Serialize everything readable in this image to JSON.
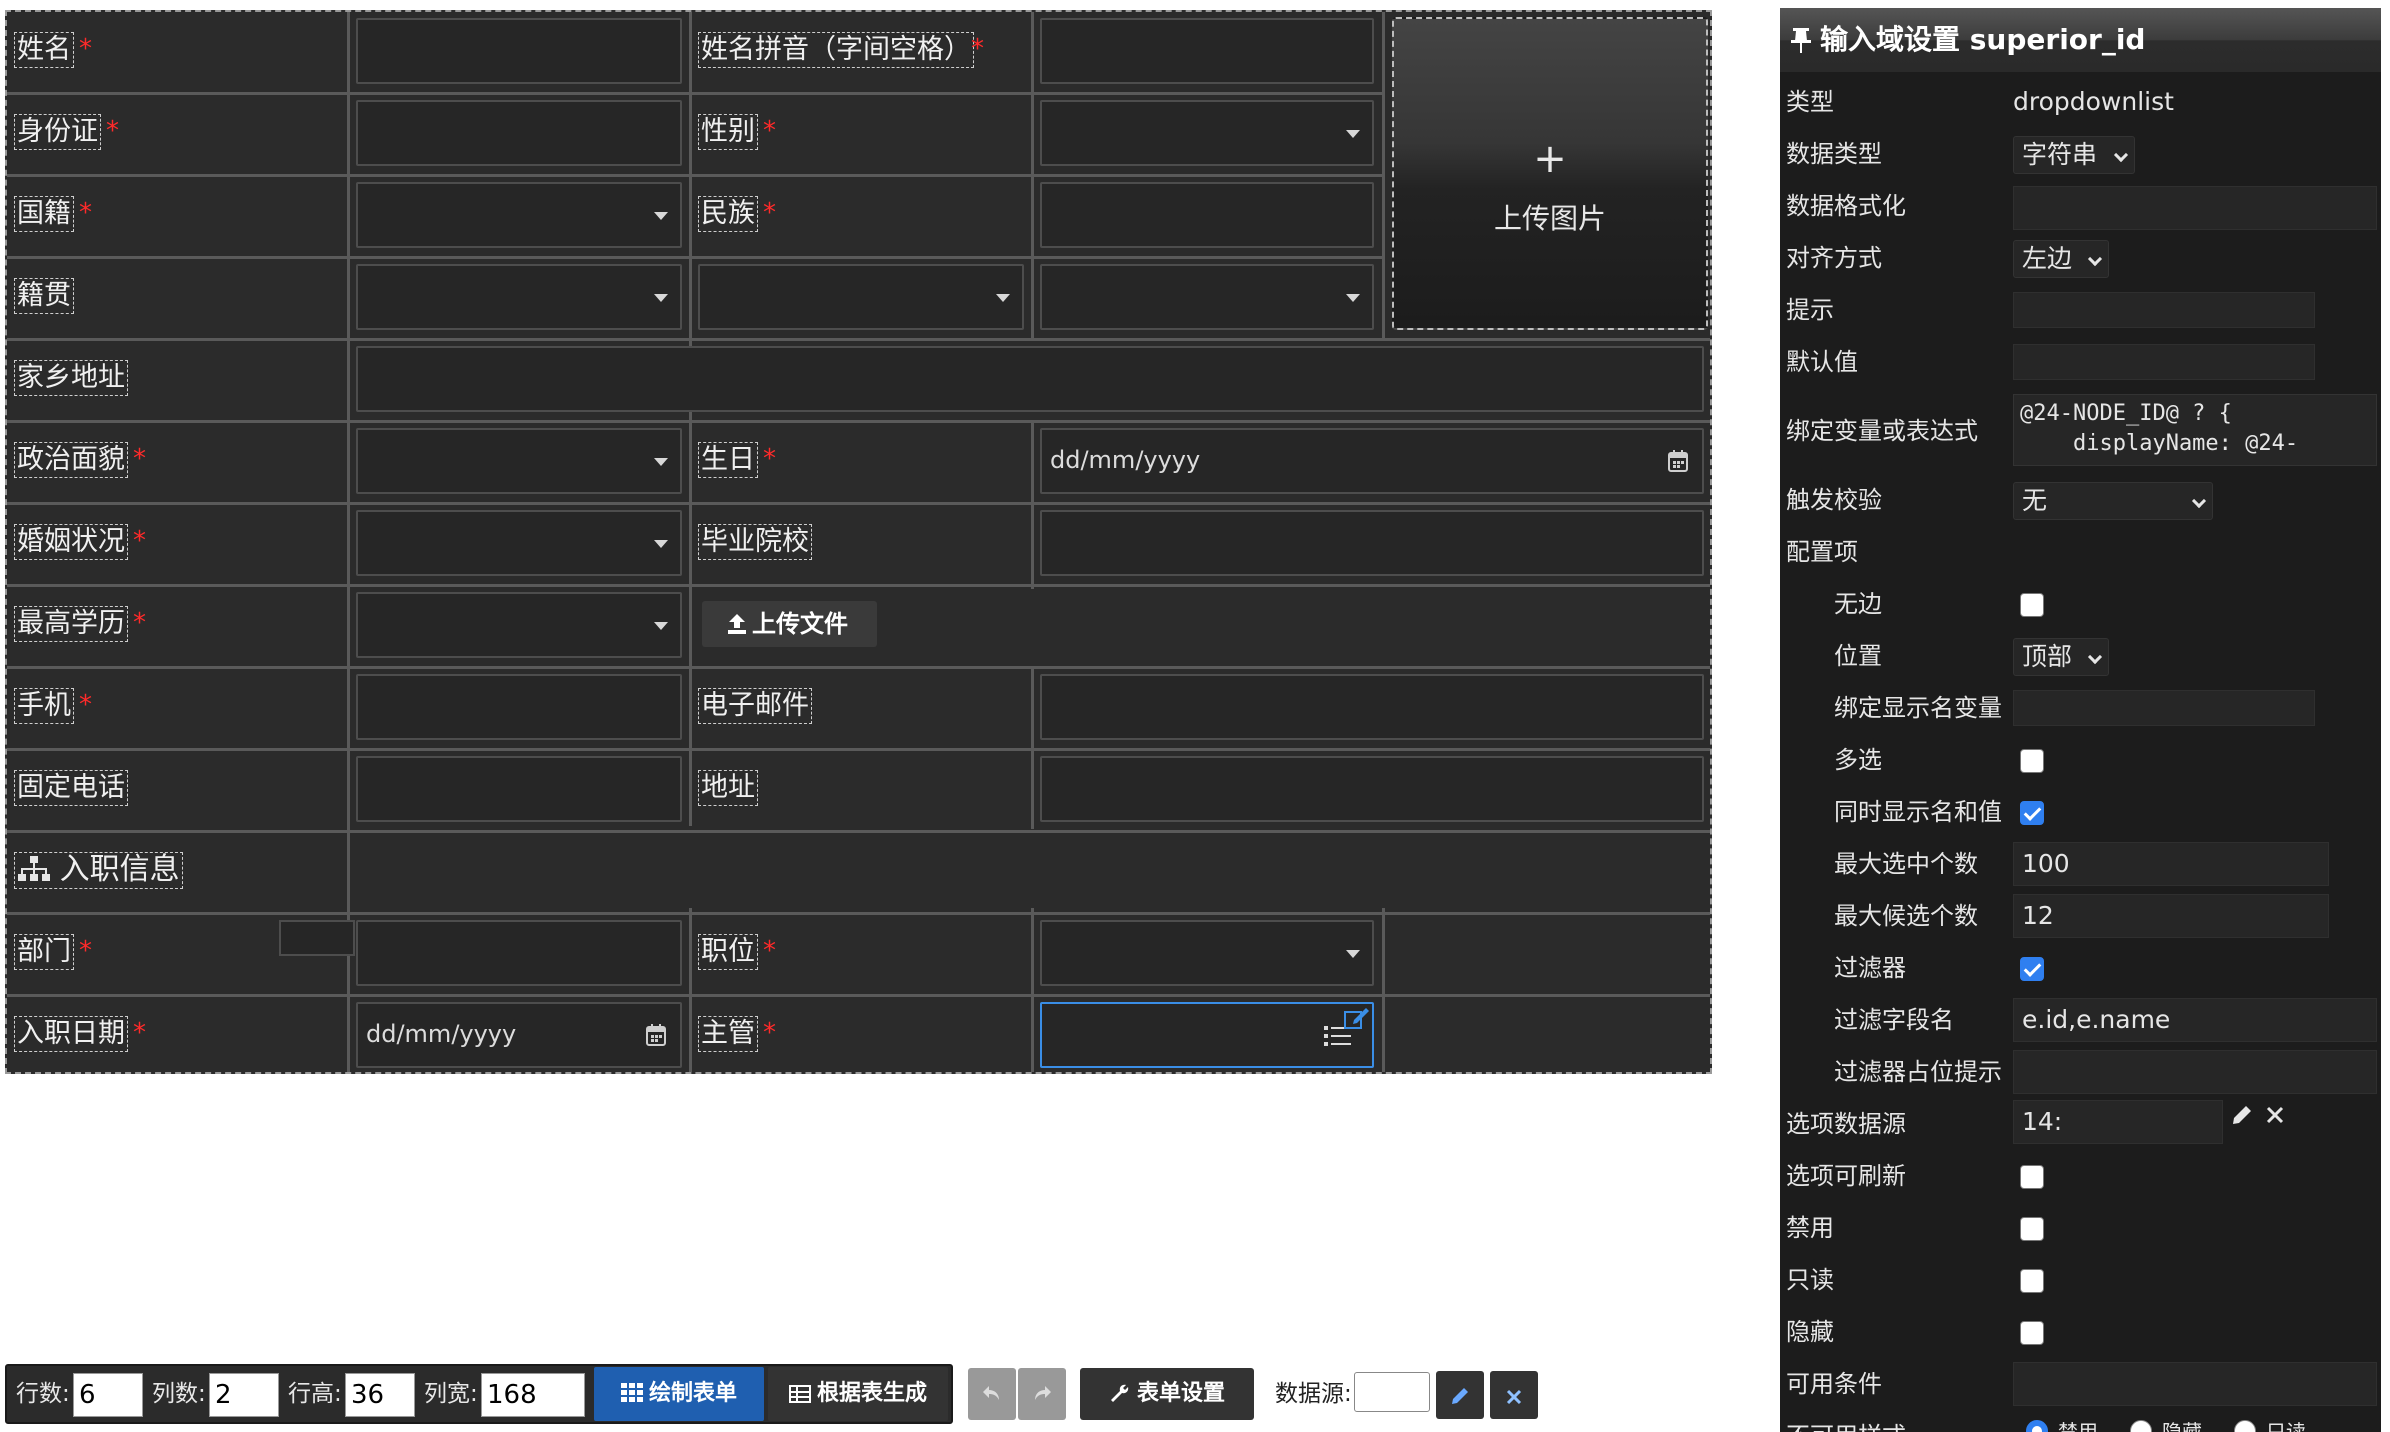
{
  "form": {
    "name_label": "姓名",
    "pinyin_label": "姓名拼音（字间空格）",
    "id_label": "身份证",
    "gender_label": "性别",
    "nationality_label": "国籍",
    "ethnicity_label": "民族",
    "native_place_label": "籍贯",
    "hometown_label": "家乡地址",
    "political_label": "政治面貌",
    "birthday_label": "生日",
    "birthday_placeholder": "dd/mm/yyyy",
    "marital_label": "婚姻状况",
    "school_label": "毕业院校",
    "education_label": "最高学历",
    "upload_file": "上传文件",
    "mobile_label": "手机",
    "email_label": "电子邮件",
    "phone_label": "固定电话",
    "address_label": "地址",
    "section_title": "入职信息",
    "dept_label": "部门",
    "position_label": "职位",
    "hire_date_label": "入职日期",
    "hire_date_placeholder": "dd/mm/yyyy",
    "supervisor_label": "主管",
    "upload_image": "上传图片",
    "required_mark": "*"
  },
  "toolbar": {
    "rows_label": "行数:",
    "rows_value": "6",
    "cols_label": "列数:",
    "cols_value": "2",
    "row_height_label": "行高:",
    "row_height_value": "36",
    "col_width_label": "列宽:",
    "col_width_value": "168",
    "draw_form": "绘制表单",
    "gen_from_table": "根据表生成",
    "form_settings": "表单设置",
    "datasource_label": "数据源:"
  },
  "panel": {
    "title": "输入域设置 superior_id",
    "type_label": "类型",
    "type_value": "dropdownlist",
    "datatype_label": "数据类型",
    "datatype_value": "字符串",
    "format_label": "数据格式化",
    "align_label": "对齐方式",
    "align_value": "左边",
    "hint_label": "提示",
    "default_label": "默认值",
    "bind_label": "绑定变量或表达式",
    "bind_value": "@24-NODE_ID@ ? {\n    displayName: @24-",
    "validate_label": "触发校验",
    "validate_value": "无",
    "config_label": "配置项",
    "noborder_label": "无边",
    "position_label": "位置",
    "position_value": "顶部",
    "bind_display_label": "绑定显示名变量",
    "multi_label": "多选",
    "show_both_label": "同时显示名和值",
    "max_selected_label": "最大选中个数",
    "max_selected_value": "100",
    "max_candidates_label": "最大候选个数",
    "max_candidates_value": "12",
    "filter_label": "过滤器",
    "filter_fields_label": "过滤字段名",
    "filter_fields_value": "e.id,e.name",
    "filter_placeholder_label": "过滤器占位提示",
    "options_source_label": "选项数据源",
    "options_source_value": "14:",
    "refreshable_label": "选项可刷新",
    "disabled_label": "禁用",
    "readonly_label": "只读",
    "hidden_label": "隐藏",
    "available_label": "可用条件",
    "unavailable_style_label": "不可用样式",
    "radio_disable": "禁用",
    "radio_hide": "隐藏",
    "radio_readonly": "只读"
  },
  "colors": {
    "form_bg": "#2b2b2b",
    "panel_bg": "#1c1c1c",
    "accent_blue": "#2f7ff0",
    "primary_button": "#1f5fb0",
    "required_red": "#ff2a2a"
  }
}
